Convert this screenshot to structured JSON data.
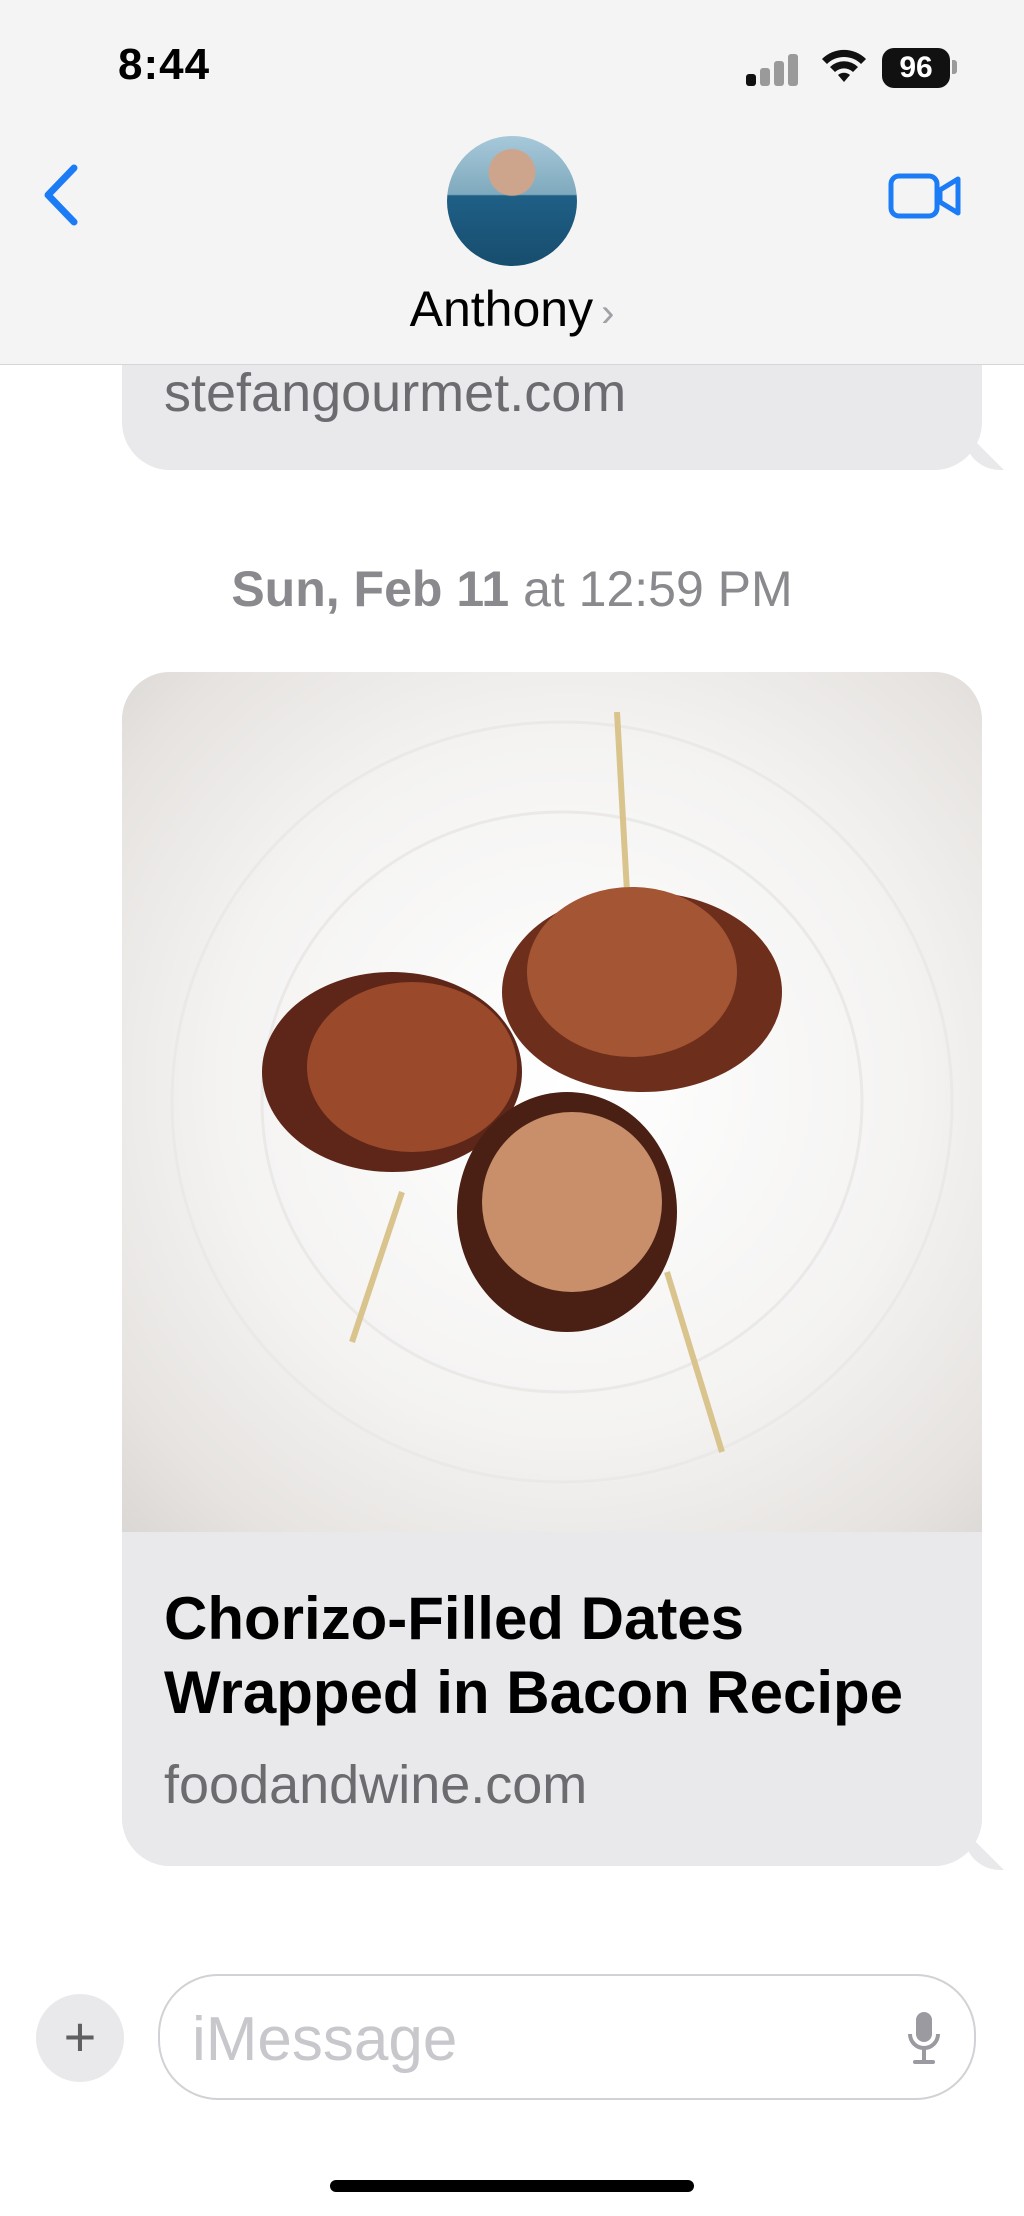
{
  "status_bar": {
    "time": "8:44",
    "battery": "96"
  },
  "header": {
    "contact_name": "Anthony",
    "chevron": "›"
  },
  "messages": {
    "previous_link_domain": "stefangourmet.com",
    "timestamp_day": "Sun, Feb 11",
    "timestamp_rest": " at 12:59 PM",
    "link_title": "Chorizo-Filled Dates Wrapped in Bacon Recipe",
    "link_domain": "foodandwine.com"
  },
  "composer": {
    "placeholder": "iMessage",
    "plus": "+"
  },
  "colors": {
    "accent": "#1b7cf5",
    "bubble": "#e9e9eb"
  },
  "icons": [
    "back-chevron-icon",
    "video-camera-icon",
    "signal-icon",
    "wifi-icon",
    "battery-icon",
    "microphone-icon",
    "plus-icon"
  ]
}
